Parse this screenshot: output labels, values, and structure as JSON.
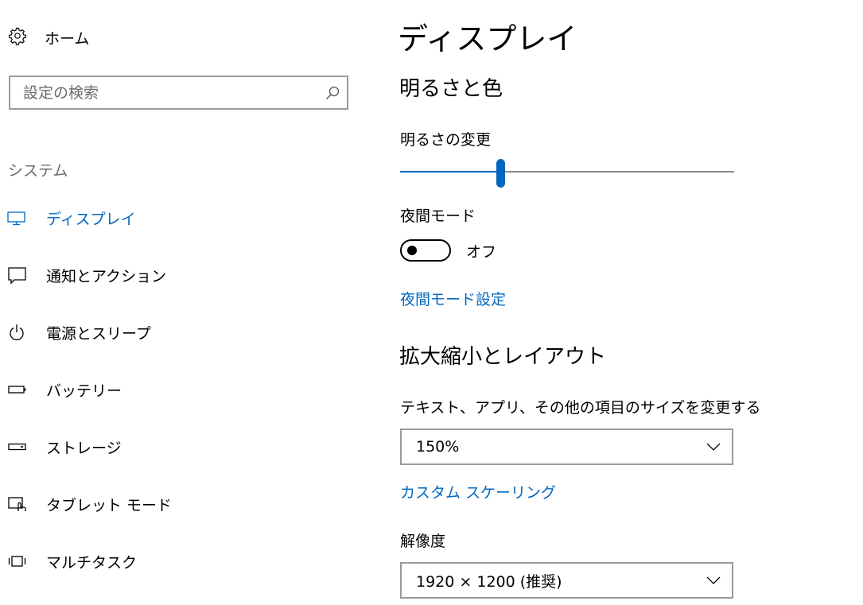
{
  "sidebar": {
    "home_label": "ホーム",
    "search_placeholder": "設定の検索",
    "section_title": "システム",
    "items": [
      {
        "label": "ディスプレイ",
        "icon": "monitor-icon",
        "active": true
      },
      {
        "label": "通知とアクション",
        "icon": "notification-icon"
      },
      {
        "label": "電源とスリープ",
        "icon": "power-icon"
      },
      {
        "label": "バッテリー",
        "icon": "battery-icon"
      },
      {
        "label": "ストレージ",
        "icon": "storage-icon"
      },
      {
        "label": "タブレット モード",
        "icon": "tablet-mode-icon"
      },
      {
        "label": "マルチタスク",
        "icon": "multitasking-icon"
      }
    ]
  },
  "main": {
    "title": "ディスプレイ",
    "brightness_section": "明るさと色",
    "brightness_label": "明るさの変更",
    "brightness_value": 0.3,
    "night_mode_label": "夜間モード",
    "night_mode_state": "オフ",
    "night_mode_settings_link": "夜間モード設定",
    "scale_section": "拡大縮小とレイアウト",
    "scale_label": "テキスト、アプリ、その他の項目のサイズを変更する",
    "scale_value": "150%",
    "custom_scaling_link": "カスタム スケーリング",
    "resolution_label": "解像度",
    "resolution_value": "1920 × 1200 (推奨)"
  },
  "colors": {
    "accent": "#0067c0",
    "border": "#9a9a9a"
  }
}
